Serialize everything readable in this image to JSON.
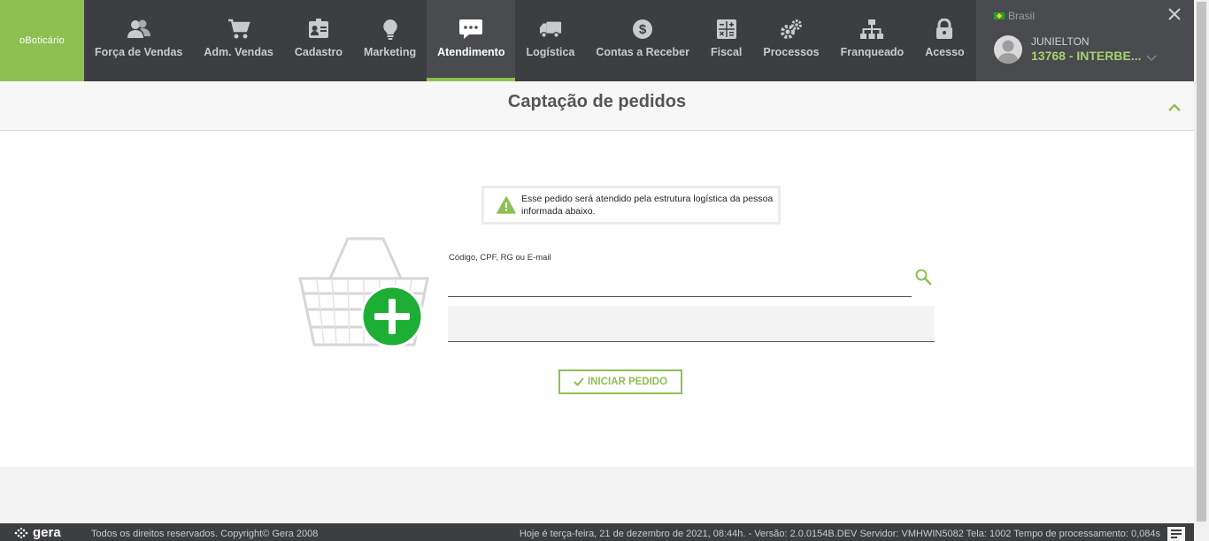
{
  "brand": {
    "label": "oBoticário"
  },
  "nav": {
    "items": [
      {
        "label": "Força de Vendas",
        "icon": "people-icon"
      },
      {
        "label": "Adm. Vendas",
        "icon": "cart-icon"
      },
      {
        "label": "Cadastro",
        "icon": "id-card-icon"
      },
      {
        "label": "Marketing",
        "icon": "lightbulb-icon"
      },
      {
        "label": "Atendimento",
        "icon": "chat-icon",
        "active": true
      },
      {
        "label": "Logística",
        "icon": "truck-icon"
      },
      {
        "label": "Contas a Receber",
        "icon": "dollar-icon"
      },
      {
        "label": "Fiscal",
        "icon": "calculator-icon"
      },
      {
        "label": "Processos",
        "icon": "gears-icon"
      },
      {
        "label": "Franqueado",
        "icon": "hierarchy-icon"
      },
      {
        "label": "Acesso",
        "icon": "lock-icon"
      }
    ]
  },
  "user": {
    "country": "Brasil",
    "name": "JUNIELTON",
    "code": "13768 - INTERBE..."
  },
  "page": {
    "title": "Captação de pedidos"
  },
  "alert": {
    "message": "Esse pedido será atendido pela estrutura logística da pessoa informada abaixo."
  },
  "form": {
    "search_label": "Código, CPF, RG ou E-mail",
    "search_value": "",
    "start_button": "INICIAR PEDIDO"
  },
  "footer": {
    "logo_text": "gera",
    "copyright": "Todos os direitos reservados. Copyright© Gera 2008",
    "info": "Hoje é terça-feira, 21 de dezembro de 2021, 08:44h. - Versão: 2.0.0154B.DEV Servidor: VMHWIN5082 Tela: 1002 Tempo de processamento: 0,084s"
  },
  "colors": {
    "accent": "#8cc152",
    "topbar": "#3d3e41",
    "active_tab": "#4a4b4e",
    "add_green": "#1fae35"
  }
}
